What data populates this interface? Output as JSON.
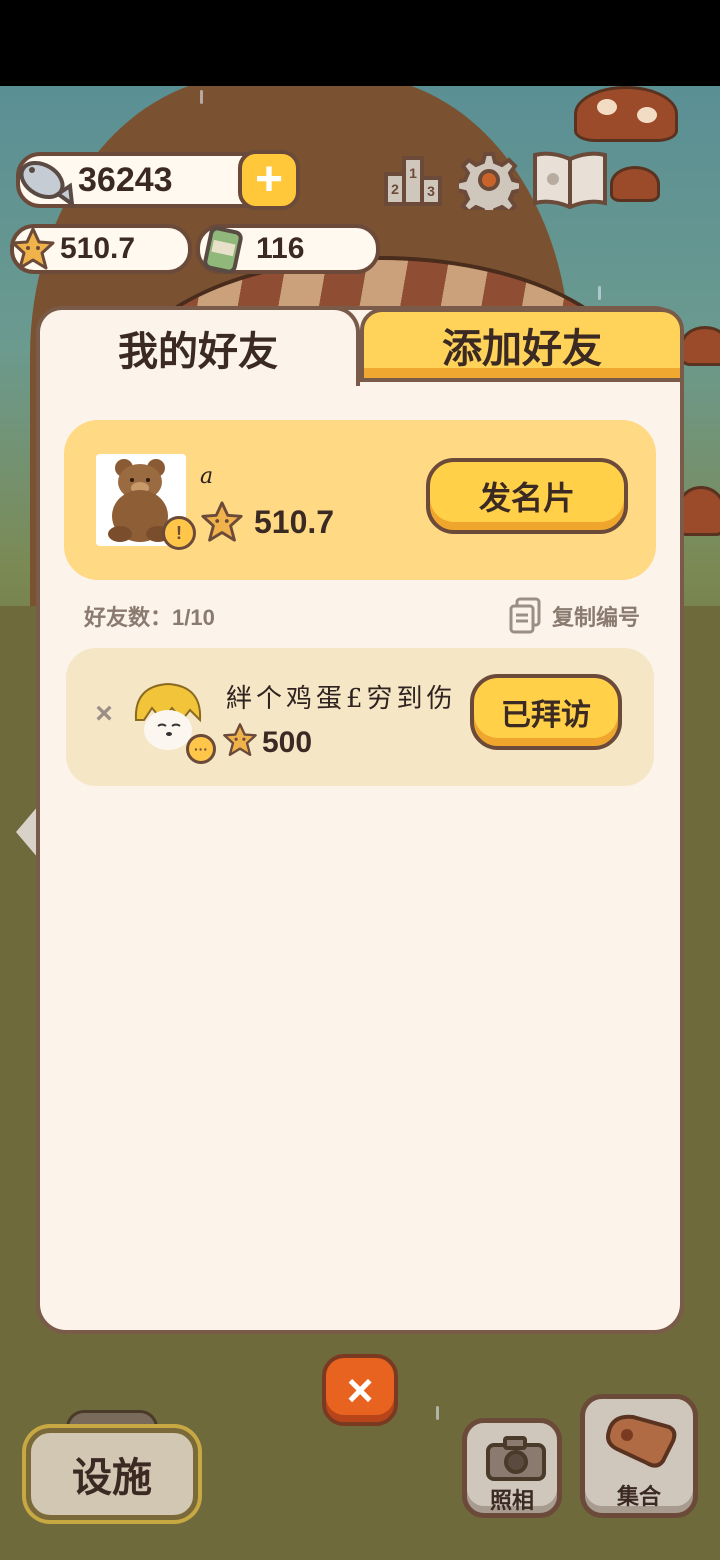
{
  "hud": {
    "fish_count": "36243",
    "star_rating": "510.7",
    "can_count": "116",
    "icons": [
      "fish-icon",
      "plus-icon",
      "star-icon",
      "can-icon",
      "leaderboard-icon",
      "gear-icon",
      "book-icon"
    ]
  },
  "tabs": {
    "my_friends": "我的好友",
    "add_friend": "添加好友"
  },
  "me": {
    "name": "a",
    "score": "510.7",
    "card_button": "发名片"
  },
  "meta": {
    "friend_count_label": "好友数：1/10",
    "copy_id_label": "复制编号"
  },
  "friends": [
    {
      "name": "絆个鸡蛋£穷到伤",
      "score": "500",
      "action": "已拜访",
      "remove": "×"
    }
  ],
  "bottom": {
    "close": "×",
    "facility": "设施",
    "photo": "照相",
    "gather": "集合"
  },
  "colors": {
    "accent_yellow": "#ffd048",
    "panel": "#fcf4ea",
    "border_brown": "#7a5a48",
    "close_orange": "#e8631f"
  }
}
